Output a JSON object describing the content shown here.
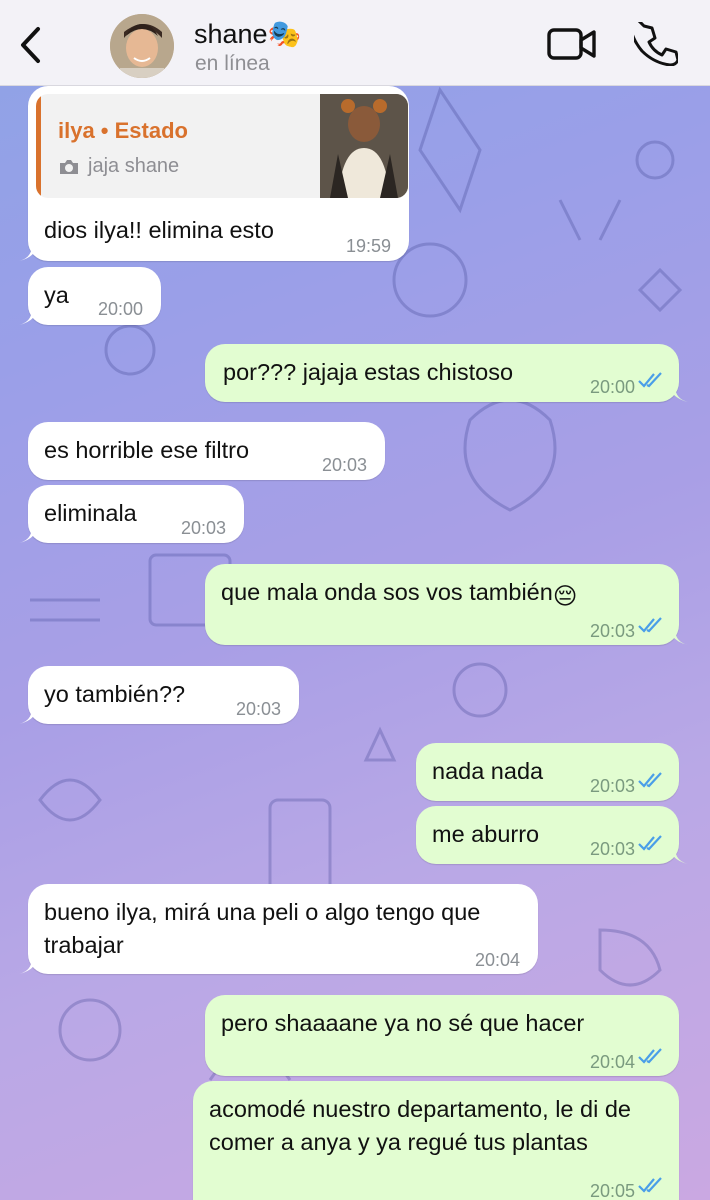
{
  "header": {
    "contact_name": "shane🎭",
    "status": "en línea"
  },
  "messages": [
    {
      "id": "m1",
      "dir": "in",
      "reply": {
        "title": "ilya • Estado",
        "text": "jaja shane"
      },
      "text": "dios ilya!! elimina esto",
      "time": "19:59"
    },
    {
      "id": "m2",
      "dir": "in",
      "text": "ya",
      "time": "20:00"
    },
    {
      "id": "m3",
      "dir": "out",
      "text": "por??? jajaja estas chistoso",
      "time": "20:00"
    },
    {
      "id": "m4",
      "dir": "in",
      "text": "es horrible ese filtro",
      "time": "20:03"
    },
    {
      "id": "m5",
      "dir": "in",
      "text": "eliminala",
      "time": "20:03"
    },
    {
      "id": "m6",
      "dir": "out",
      "text": "que mala onda sos vos también",
      "emoji": "😔",
      "time": "20:03"
    },
    {
      "id": "m7",
      "dir": "in",
      "text": "yo también??",
      "time": "20:03"
    },
    {
      "id": "m8",
      "dir": "out",
      "text": "nada nada",
      "time": "20:03"
    },
    {
      "id": "m9",
      "dir": "out",
      "text": "me aburro",
      "time": "20:03"
    },
    {
      "id": "m10",
      "dir": "in",
      "text": "bueno ilya, mirá una peli o algo tengo que trabajar",
      "time": "20:04"
    },
    {
      "id": "m11",
      "dir": "out",
      "text": "pero shaaaane ya no sé que hacer",
      "time": "20:04"
    },
    {
      "id": "m12",
      "dir": "out",
      "text": "acomodé nuestro departamento, le di de comer a anya y ya regué tus plantas",
      "time": "20:05"
    }
  ],
  "colors": {
    "incoming_bubble": "#ffffff",
    "outgoing_bubble": "#e2fdd1",
    "read_ticks": "#4a9ee8",
    "reply_accent": "#d9722d"
  },
  "icons": [
    "chevron-left-icon",
    "video-camera-icon",
    "phone-icon",
    "camera-icon",
    "double-check-icon"
  ]
}
